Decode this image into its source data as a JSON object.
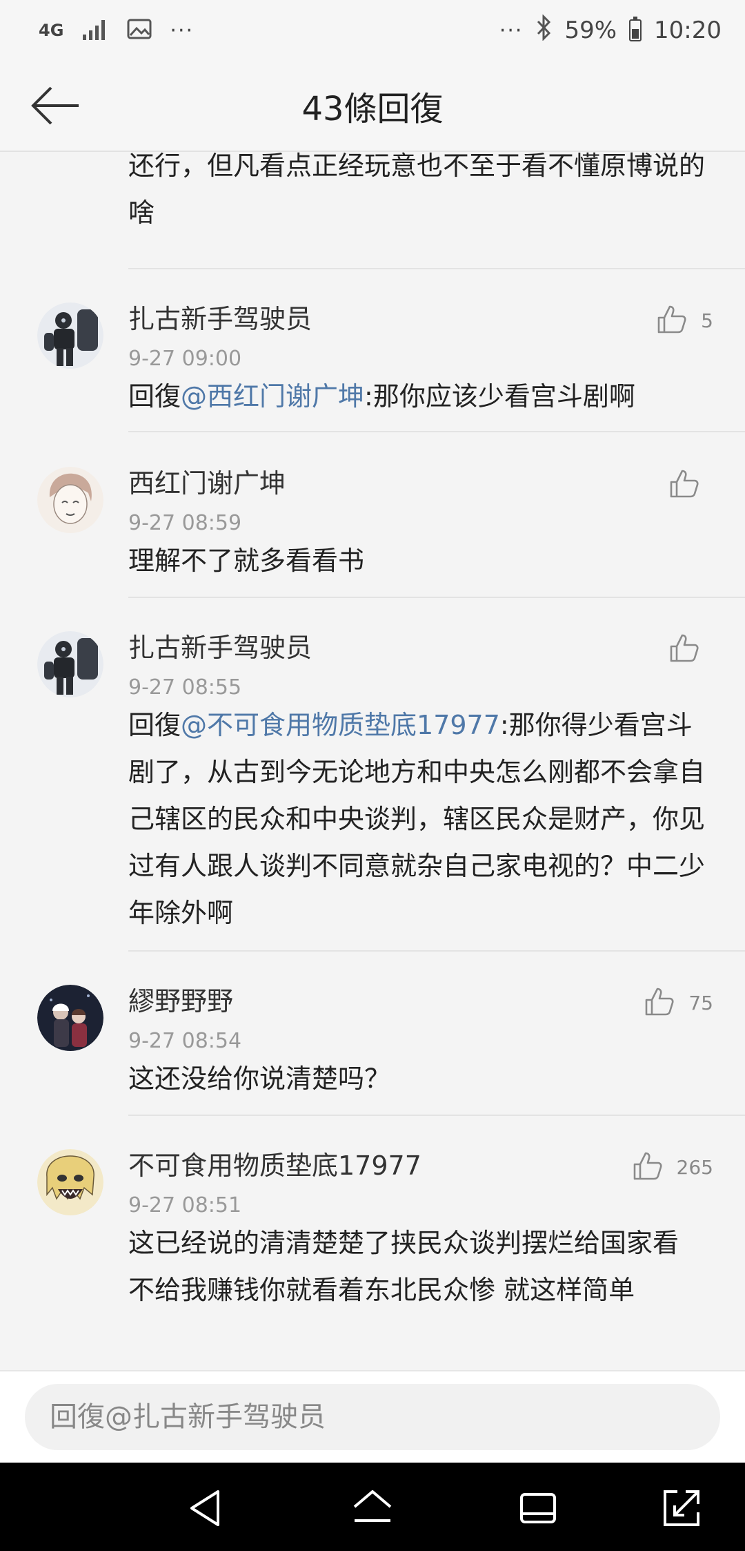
{
  "status_bar": {
    "network": "4G",
    "battery_pct_text": "59%",
    "battery_level": 0.59,
    "time": "10:20",
    "dots": "···"
  },
  "header": {
    "title": "43條回復"
  },
  "partial_comment": {
    "line1": "还行，但凡看点正经玩意也不至于看不懂原博说的啥"
  },
  "comments": [
    {
      "username": "扎古新手驾驶员",
      "time": "9-27 09:00",
      "likes": "5",
      "prefix": "回復",
      "mention": "@西红门谢广坤",
      "text": ":那你应该少看宫斗剧啊"
    },
    {
      "username": "西红门谢广坤",
      "time": "9-27 08:59",
      "likes": "",
      "prefix": "",
      "mention": "",
      "text": "理解不了就多看看书"
    },
    {
      "username": "扎古新手驾驶员",
      "time": "9-27 08:55",
      "likes": "",
      "prefix": "回復",
      "mention": "@不可食用物质垫底17977",
      "text": ":那你得少看宫斗剧了，从古到今无论地方和中央怎么刚都不会拿自己辖区的民众和中央谈判，辖区民众是财产，你见过有人跟人谈判不同意就杂自己家电视的？中二少年除外啊"
    },
    {
      "username": "繆野野野",
      "time": "9-27 08:54",
      "likes": "75",
      "prefix": "",
      "mention": "",
      "text": "这还没给你说清楚吗？"
    },
    {
      "username": "不可食用物质垫底17977",
      "time": "9-27 08:51",
      "likes": "265",
      "prefix": "",
      "mention": "",
      "text": "这已经说的清清楚楚了挟民众谈判摆烂给国家看  不给我赚钱你就看着东北民众惨  就这样简单"
    }
  ],
  "reply_bar": {
    "placeholder": "回復@扎古新手驾驶员"
  },
  "colors": {
    "mention": "#4f78a8",
    "background": "#f4f4f4",
    "nav_bar": "#000000"
  }
}
